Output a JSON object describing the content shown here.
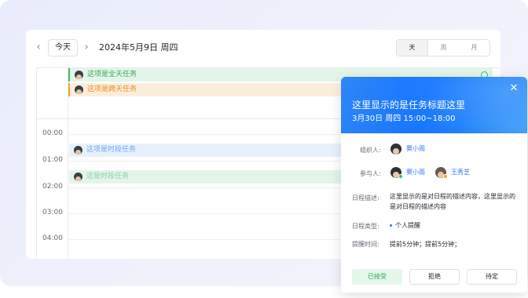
{
  "toolbar": {
    "prev_icon": "chevron-left-icon",
    "today_label": "今天",
    "next_icon": "chevron-right-icon",
    "date_title": "2024年5月9日 周四",
    "views": [
      "天",
      "周",
      "月"
    ],
    "active_view": "天"
  },
  "allday_events": [
    {
      "title": "这项是全天任务",
      "color": "#34c26a"
    },
    {
      "title": "这项是跨天任务",
      "color": "#f5a623"
    }
  ],
  "time_labels": [
    "00:00",
    "01:00",
    "02:00",
    "03:00",
    "04:00"
  ],
  "timed_events": [
    {
      "title": "这项是时段任务",
      "color": "#6ea7f0"
    },
    {
      "title": "这是时段任务",
      "color": "#8bcfa3"
    }
  ],
  "popup": {
    "title": "这里显示的是任务标题这里",
    "time": "3月30日 周四 15:00~18:00",
    "close_icon": "close-icon",
    "organizer_label": "组织人:",
    "organizer_name": "窦小雨",
    "participants_label": "参与人:",
    "participants": [
      {
        "name": "窦小雨",
        "status_color": "#34c26a"
      },
      {
        "name": "王秀芝",
        "status_color": "#f5a623"
      }
    ],
    "description_label": "日程描述:",
    "description": "这里显示的是对日程的描述内容，这里显示的是对日程的描述内容",
    "type_label": "日程类型:",
    "type_value": "个人提醒",
    "reminder_label": "提醒时间:",
    "reminder_value": "提前5分钟；提前5分钟；",
    "accept_label": "已接受",
    "reject_label": "拒绝",
    "pending_label": "待定"
  },
  "colors": {
    "accent": "#1677ff",
    "accepted_bg": "#e4f7eb",
    "accepted_text": "#34a853"
  }
}
